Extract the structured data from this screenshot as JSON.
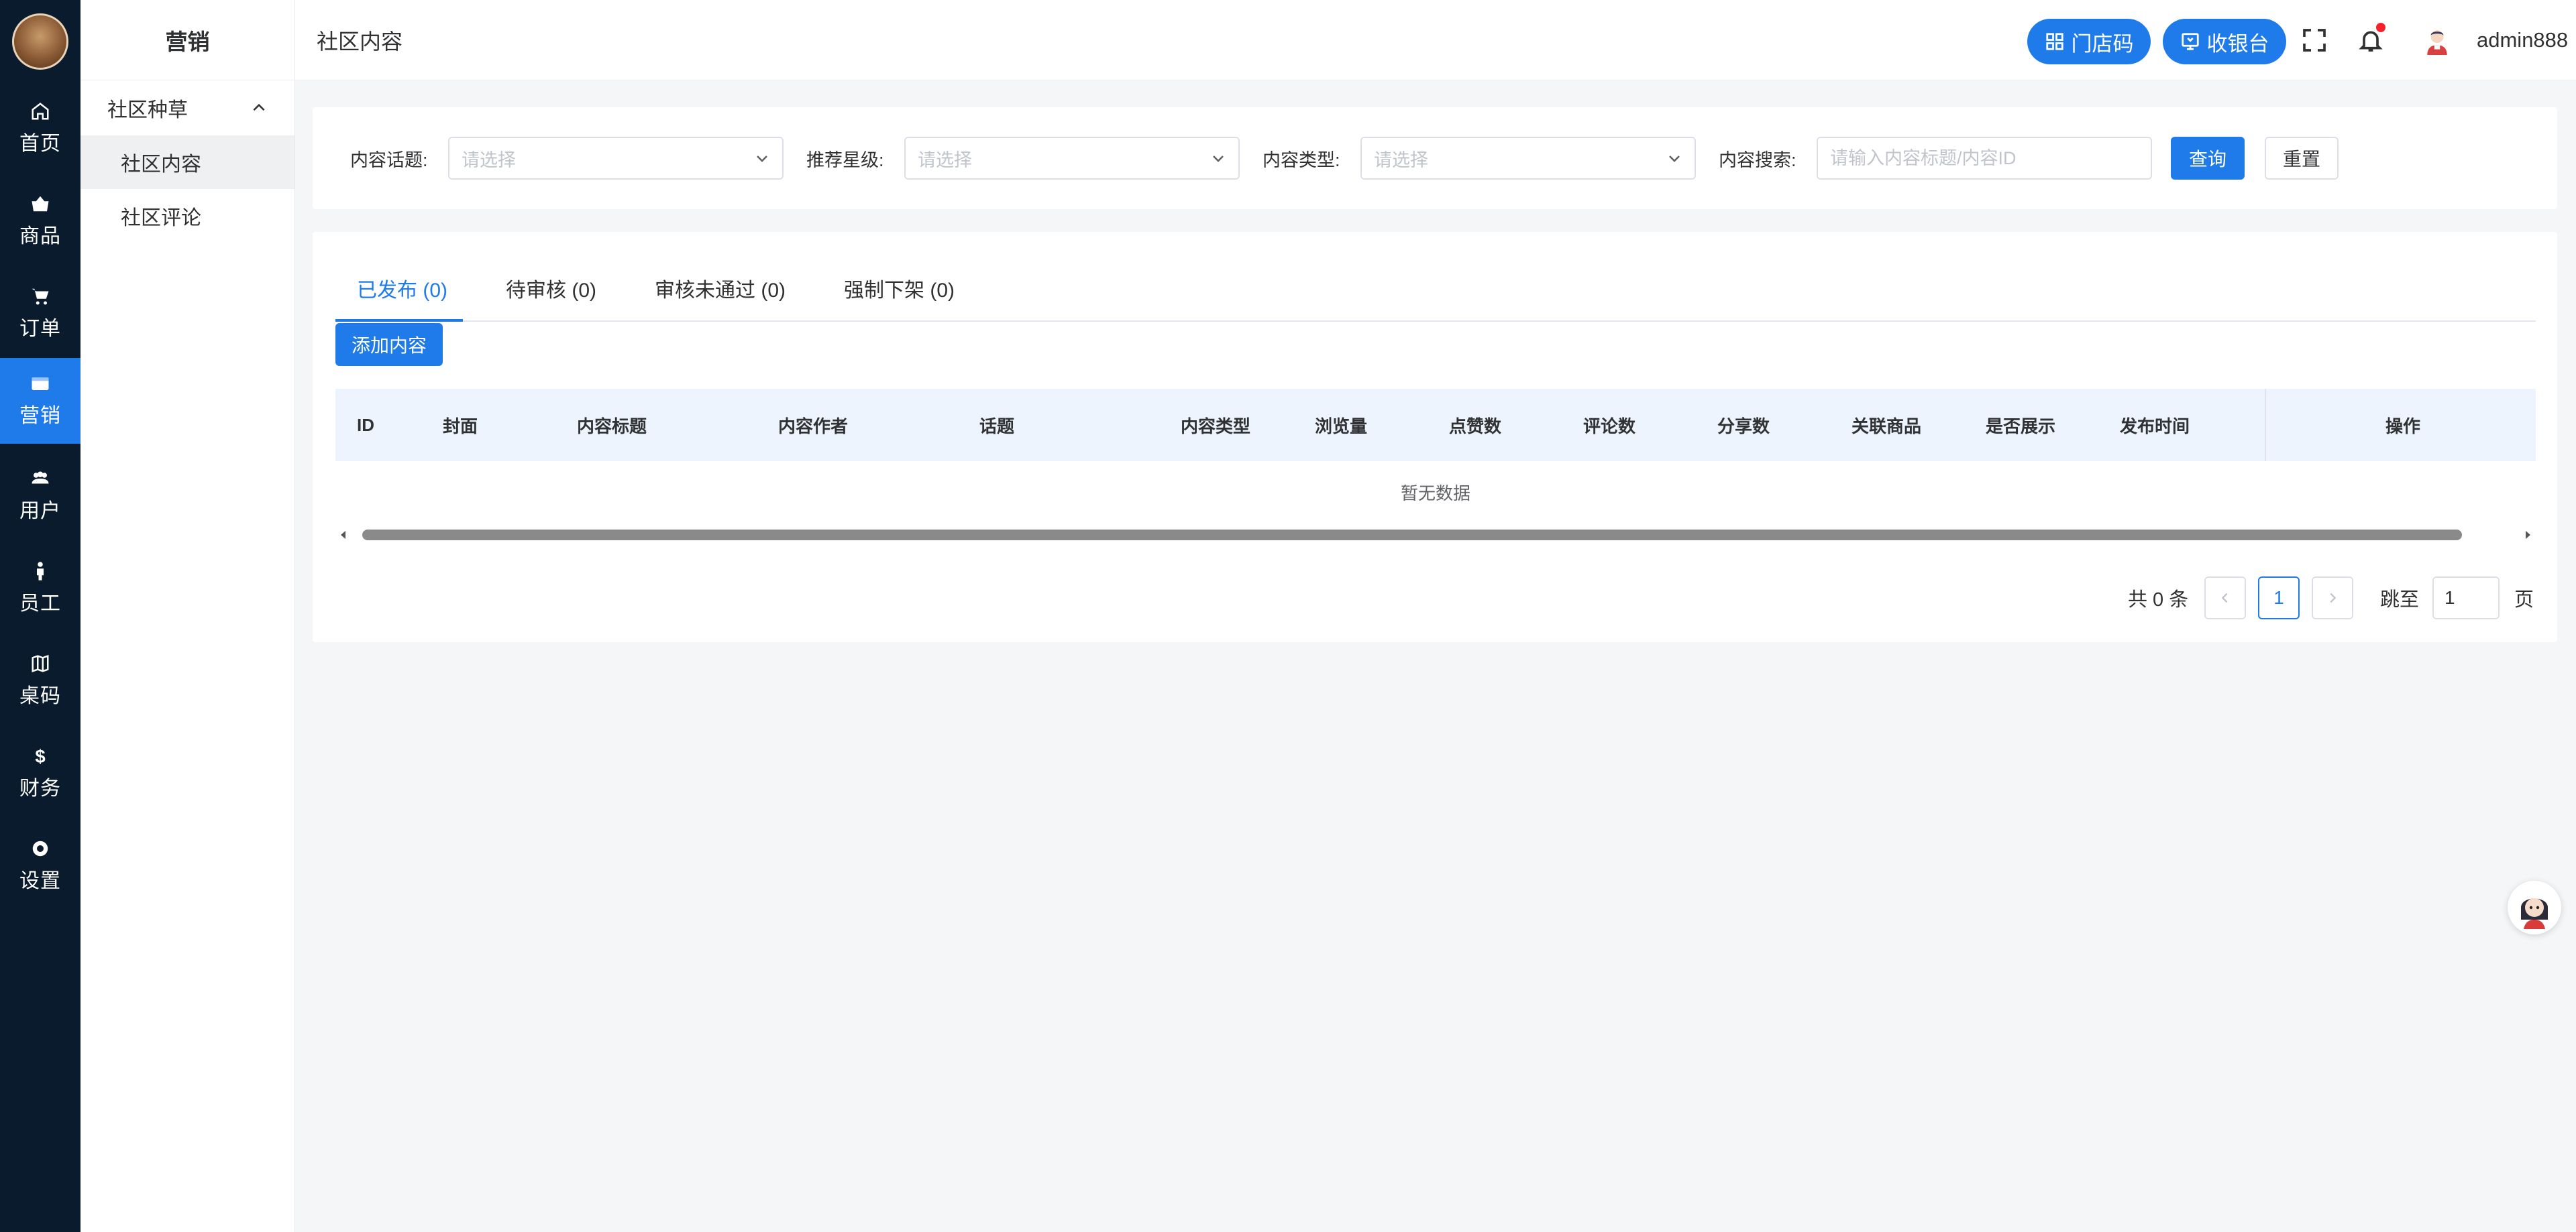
{
  "rail": {
    "items": [
      {
        "label": "首页",
        "icon": "home-icon"
      },
      {
        "label": "商品",
        "icon": "shopping-basket-icon"
      },
      {
        "label": "订单",
        "icon": "cart-icon"
      },
      {
        "label": "营销",
        "icon": "marketing-icon"
      },
      {
        "label": "用户",
        "icon": "users-icon"
      },
      {
        "label": "员工",
        "icon": "staff-icon"
      },
      {
        "label": "桌码",
        "icon": "table-code-icon"
      },
      {
        "label": "财务",
        "icon": "dollar-icon"
      },
      {
        "label": "设置",
        "icon": "settings-icon"
      }
    ],
    "active_index": 3
  },
  "submenu": {
    "title": "营销",
    "group_label": "社区种草",
    "items": [
      "社区内容",
      "社区评论"
    ],
    "active_index": 0
  },
  "header": {
    "breadcrumb": "社区内容",
    "store_code_label": "门店码",
    "cashier_label": "收银台",
    "username": "admin888"
  },
  "filter": {
    "topic_label": "内容话题:",
    "topic_placeholder": "请选择",
    "star_label": "推荐星级:",
    "star_placeholder": "请选择",
    "type_label": "内容类型:",
    "type_placeholder": "请选择",
    "search_label": "内容搜索:",
    "search_placeholder": "请输入内容标题/内容ID",
    "query_label": "查询",
    "reset_label": "重置"
  },
  "tabs": [
    {
      "label": "已发布 (0)"
    },
    {
      "label": "待审核 (0)"
    },
    {
      "label": "审核未通过 (0)"
    },
    {
      "label": "强制下架 (0)"
    }
  ],
  "active_tab": 0,
  "add_button_label": "添加内容",
  "table": {
    "columns": [
      "ID",
      "封面",
      "内容标题",
      "内容作者",
      "话题",
      "内容类型",
      "浏览量",
      "点赞数",
      "评论数",
      "分享数",
      "关联商品",
      "是否展示",
      "发布时间",
      "操作"
    ],
    "empty_text": "暂无数据"
  },
  "pagination": {
    "total_text": "共 0 条",
    "current_page": "1",
    "jump_label": "跳至",
    "jump_value": "1",
    "page_suffix": "页"
  },
  "colors": {
    "primary": "#1f7bea",
    "rail_bg": "#0a1b2e"
  }
}
